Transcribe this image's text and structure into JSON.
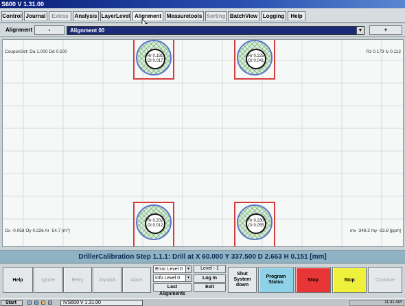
{
  "window": {
    "title": "S600 V 1.31.00"
  },
  "menu": {
    "tabs": [
      {
        "label": "Control",
        "enabled": true
      },
      {
        "label": "Journal",
        "enabled": true
      },
      {
        "label": "Extras",
        "enabled": false
      },
      {
        "label": "Analysis",
        "enabled": true
      },
      {
        "label": "LayerLevel",
        "enabled": true
      },
      {
        "label": "Alignment",
        "enabled": true,
        "active": true
      },
      {
        "label": "Measuretools",
        "enabled": true
      },
      {
        "label": "Sorting",
        "enabled": false
      },
      {
        "label": "BatchView",
        "enabled": true
      },
      {
        "label": "Logging",
        "enabled": true
      },
      {
        "label": "Help",
        "enabled": true
      }
    ]
  },
  "alignment_bar": {
    "label": "Alignment",
    "minus": "-",
    "selected": "Alignment 00",
    "plus": "+"
  },
  "plot": {
    "coupon_set": "CouponSet: Da 1.000 Dd 0.500",
    "top_right": "Rz 0.173 Iv 0.112",
    "bottom_left": "Ox -0.058 Oy 0.226 Ar -54.7 [m°]",
    "bottom_right": "mx -349.2 my -33.8 [ppm]",
    "holes": [
      {
        "rr": "Rr 0.191",
        "oi": "OI 0.017"
      },
      {
        "rr": "Rr 0.225",
        "oi": "OI 0.041"
      },
      {
        "rr": "Rr 0.202",
        "oi": "OI 0.012"
      },
      {
        "rr": "Rr 0.230",
        "oi": "OI 0.055"
      }
    ]
  },
  "status": {
    "text": "DrillerCalibration Step 1.1.1: Drill at X 60.000 Y 337.500 D  2.663 H  0.151 [mm]"
  },
  "controls": {
    "help": "Help",
    "ignore": "Ignore",
    "retry": "Retry",
    "joystick": "Joystick",
    "abort": "Abort",
    "error_level": "Error Level 0",
    "info_level": "Info  Level 0",
    "level_display": "Level - 1",
    "log_in": "Log In",
    "last_alignments": "Last Alignments",
    "exit": "Exit",
    "shut_down": "Shut System down",
    "program_status": "Program Status",
    "stop_red": "Stop",
    "stop_yellow": "Stop",
    "continue": "Continue"
  },
  "taskbar": {
    "start": "Start",
    "task": "IVS600 V 1.31.00",
    "clock": "11:41 AM",
    "colors": {
      "stop_red": "#e83636",
      "stop_yellow": "#eef03a",
      "program_status": "#8fd2e8"
    }
  }
}
